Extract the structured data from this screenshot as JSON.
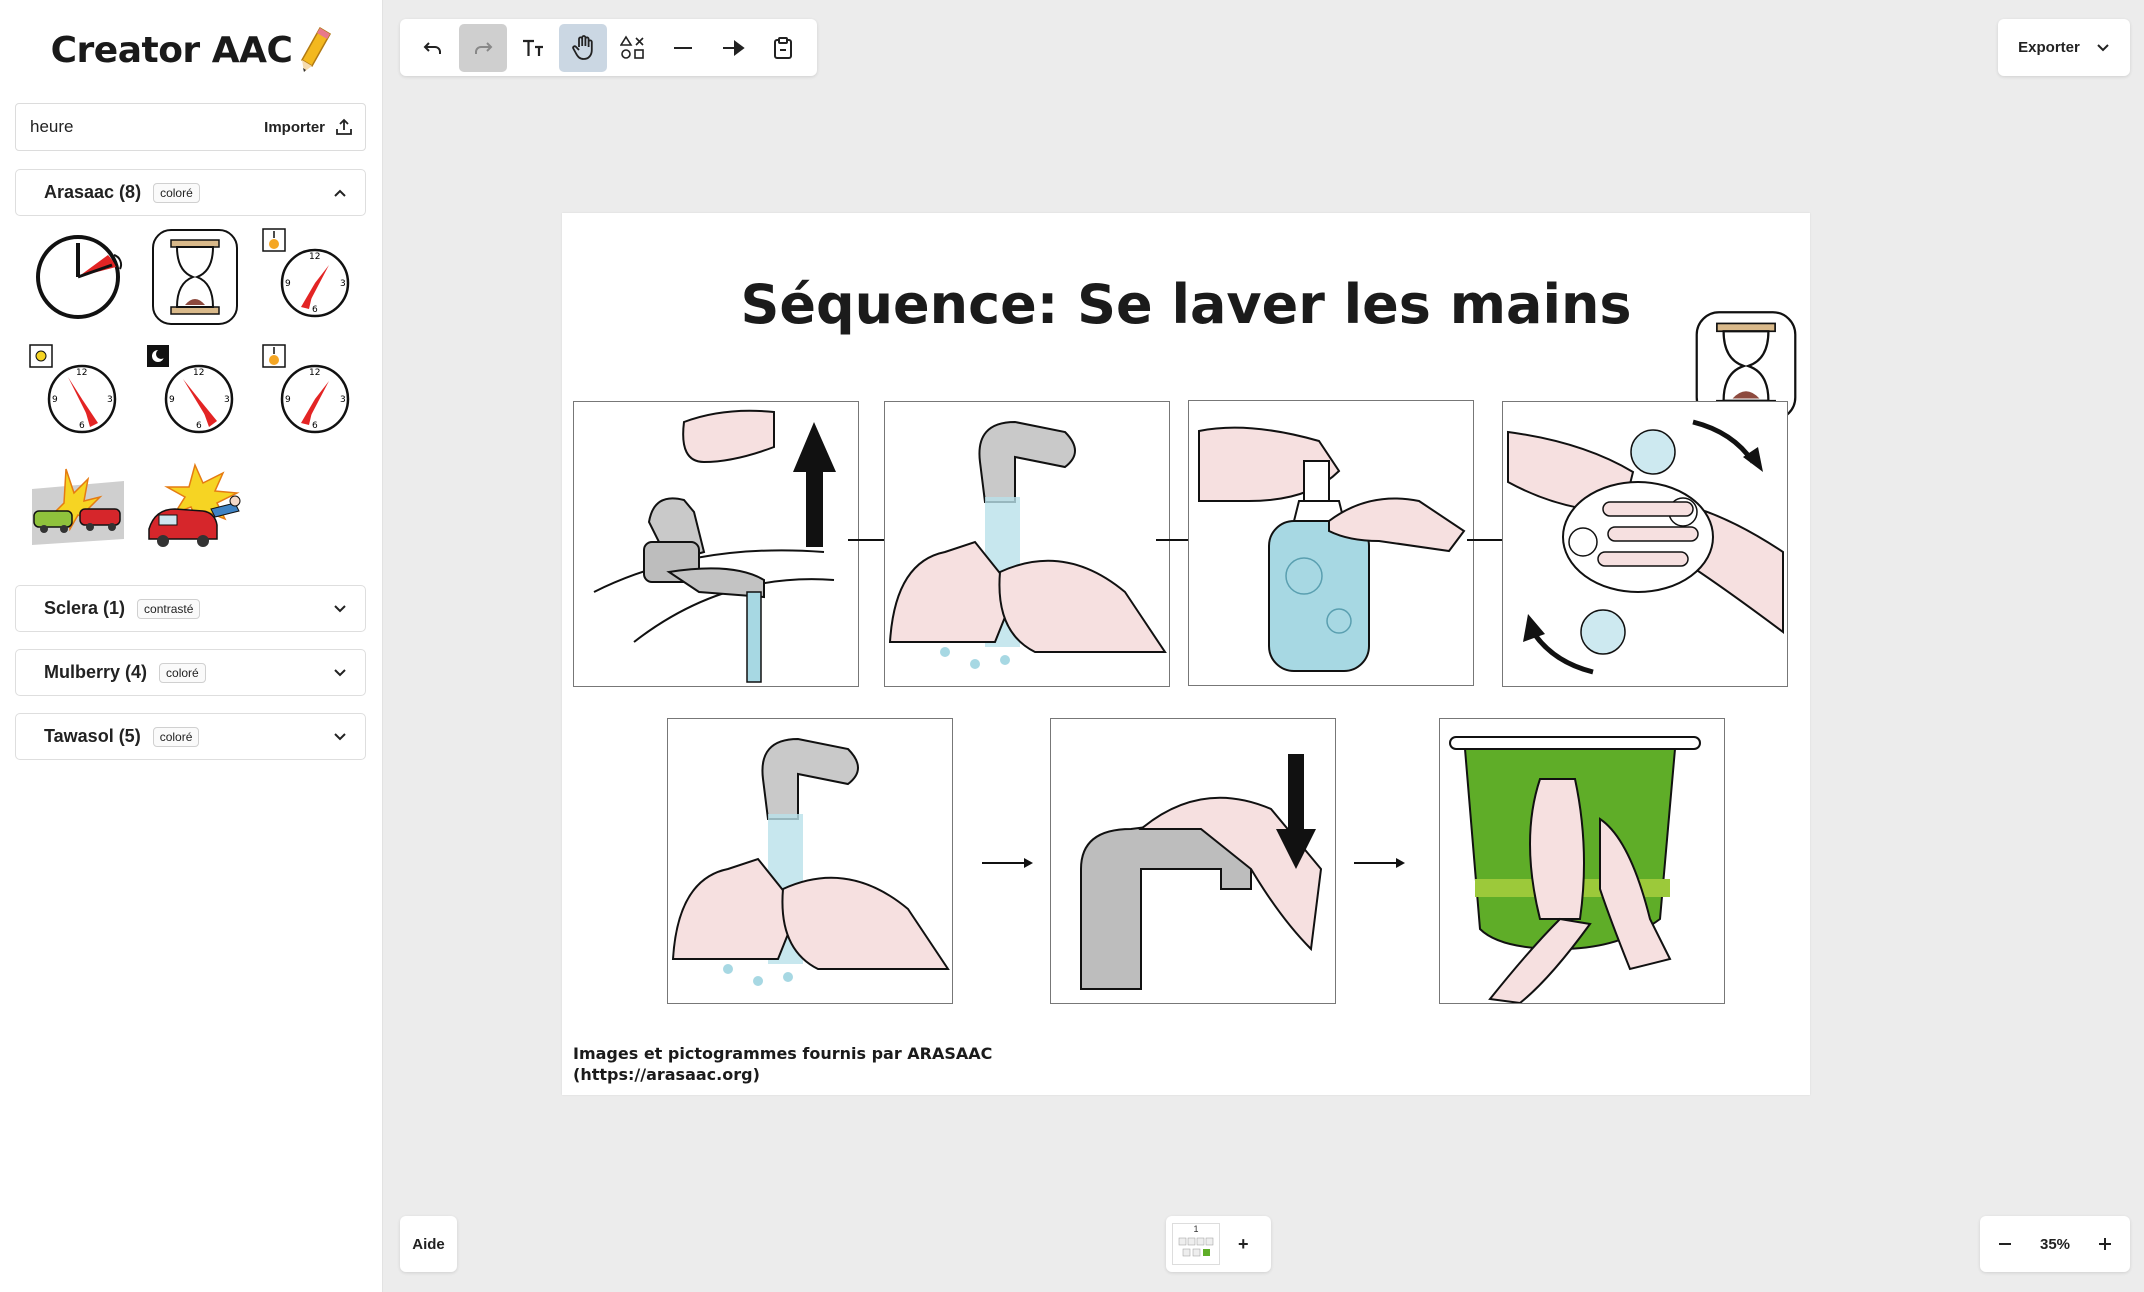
{
  "app": {
    "title": "Creator AAC",
    "logo_icon": "pencil-icon"
  },
  "search": {
    "value": "heure",
    "import_label": "Importer"
  },
  "libraries": [
    {
      "name": "Arasaac (8)",
      "tag": "coloré",
      "expanded": true
    },
    {
      "name": "Sclera (1)",
      "tag": "contrasté",
      "expanded": false
    },
    {
      "name": "Mulberry (4)",
      "tag": "coloré",
      "expanded": false
    },
    {
      "name": "Tawasol (5)",
      "tag": "coloré",
      "expanded": false
    }
  ],
  "results": [
    {
      "name": "clock-quarter-result"
    },
    {
      "name": "hourglass-result"
    },
    {
      "name": "clock-sunrise-result"
    },
    {
      "name": "clock-sun-result"
    },
    {
      "name": "clock-moon-result"
    },
    {
      "name": "clock-sunset-result"
    },
    {
      "name": "car-crash-result"
    },
    {
      "name": "car-accident-result"
    }
  ],
  "toolbar": {
    "tools": [
      "undo-icon",
      "redo-icon",
      "text-icon",
      "hand-icon",
      "shapes-icon",
      "line-icon",
      "arrow-icon",
      "clipboard-icon"
    ],
    "export_label": "Exporter"
  },
  "canvas": {
    "title": "Séquence: Se laver les mains",
    "credit_line1": "Images et pictogrammes fournis par ARASAAC",
    "credit_line2": "(https://arasaac.org)",
    "steps": [
      "open-tap",
      "wet-hands",
      "soap-pump",
      "rub-hands",
      "rinse-hands",
      "close-tap",
      "dry-hands"
    ]
  },
  "footer": {
    "help_label": "Aide",
    "page_number": "1",
    "add_page_label": "+",
    "zoom": "35%"
  },
  "colors": {
    "accent": "#cbd7e3",
    "sidebar": "#ffffff",
    "canvas_bg": "#ececec"
  }
}
